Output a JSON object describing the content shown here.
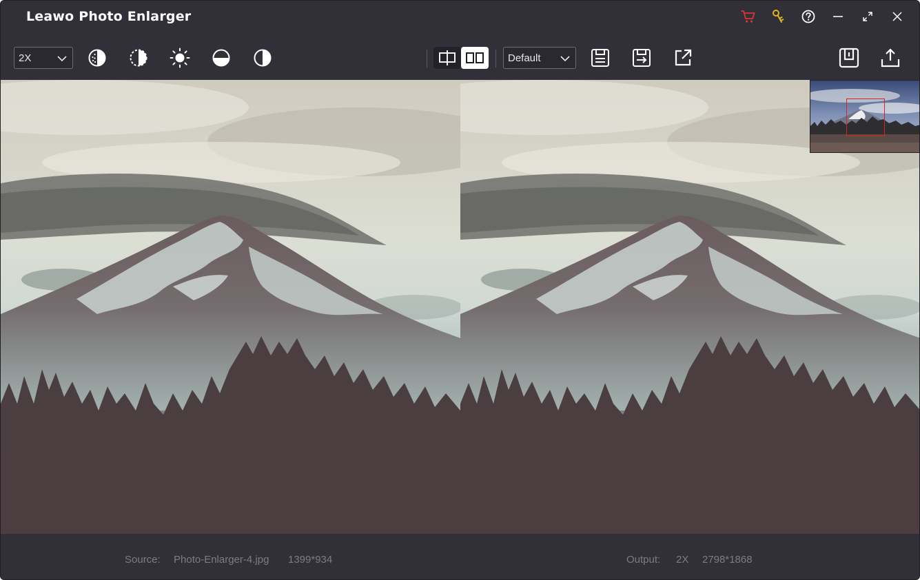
{
  "app": {
    "title": "Leawo Photo Enlarger"
  },
  "titlebar": {
    "icons": [
      "cart-icon",
      "key-icon",
      "help-icon",
      "minimize-icon",
      "maximize-icon",
      "close-icon"
    ],
    "colors": {
      "cart": "#e0332e",
      "key": "#e8b718"
    }
  },
  "toolbar": {
    "scale_value": "2X",
    "left_icons": [
      "denoise-icon",
      "saturation-icon",
      "brightness-icon",
      "exposure-icon",
      "contrast-icon"
    ],
    "view_icons": [
      "single-view-icon",
      "split-view-icon"
    ],
    "preset_value": "Default",
    "right_icons": [
      "save-icon",
      "save-as-icon",
      "open-external-icon",
      "save-all-icon",
      "export-icon"
    ]
  },
  "status": {
    "source_label": "Source:",
    "source_file": "Photo-Enlarger-4.jpg",
    "source_size": "1399*934",
    "output_label": "Output:",
    "output_scale": "2X",
    "output_size": "2798*1868"
  },
  "colors": {
    "window_bg": "#313038",
    "text_primary": "#ffffff",
    "text_muted": "#7d7c83",
    "accent_frame": "#e0221f"
  }
}
